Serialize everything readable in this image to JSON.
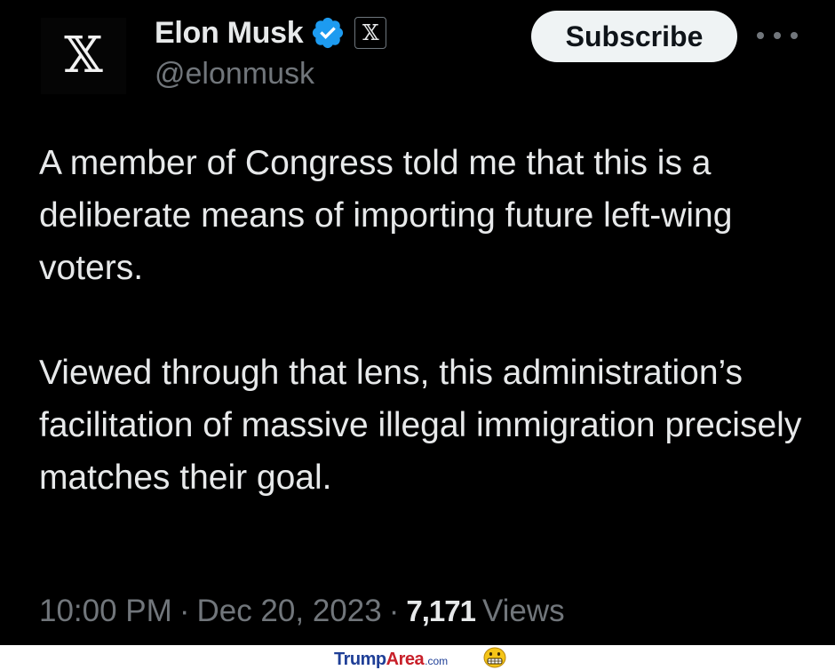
{
  "author": {
    "display_name": "Elon Musk",
    "handle": "@elonmusk",
    "avatar_icon": "x-logo-icon",
    "verified_icon": "verified-badge-icon",
    "affiliation_icon": "x-affiliation-badge-icon",
    "verified_color": "#1d9bf0"
  },
  "actions": {
    "subscribe_label": "Subscribe",
    "more_icon": "more-dots-icon"
  },
  "tweet": {
    "paragraphs": [
      "A member of Congress told me that this is a deliberate means of importing future left-wing voters.",
      "Viewed through that lens, this administration’s facilitation of massive illegal immigration precisely matches their goal."
    ]
  },
  "meta": {
    "time": "10:00 PM",
    "separator": "·",
    "date": "Dec 20, 2023",
    "views_count": "7,171",
    "views_label": "Views"
  },
  "watermark": {
    "part1": "Trump",
    "part2": "Area",
    "part3": ".com",
    "icon": "grimace-emoji-icon"
  },
  "colors": {
    "background": "#000000",
    "text": "#e7e9ea",
    "secondary_text": "#71767b",
    "button_bg": "#eff3f4"
  }
}
